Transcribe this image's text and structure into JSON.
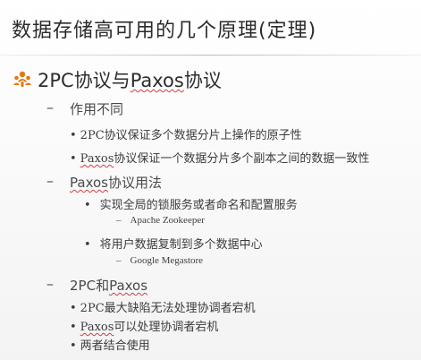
{
  "slide": {
    "title": "数据存储高可用的几个原理(定理)",
    "heading": {
      "prefix": "2PC协议与",
      "paxos": "Paxos",
      "suffix": "协议"
    },
    "sections": [
      {
        "dash": "–",
        "label": "作用不同",
        "items": [
          {
            "bullet": "•",
            "pre": "2PC协议保证多个数据分片上操作的原子性",
            "paxos": "",
            "post": ""
          },
          {
            "bullet": "•",
            "pre": "",
            "paxos": "Paxos",
            "post": "协议保证一个数据分片多个副本之间的数据一致性"
          }
        ]
      },
      {
        "dash": "–",
        "label_paxos": "Paxos",
        "label_post": "协议用法",
        "items": [
          {
            "bullet": "•",
            "text": "实现全局的锁服务或者命名和配置服务",
            "sub_dash": "–",
            "sub": "Apache Zookeeper"
          },
          {
            "bullet": "•",
            "text": "将用户数据复制到多个数据中心",
            "sub_dash": "–",
            "sub": "Google Megastore"
          }
        ]
      },
      {
        "dash": "–",
        "label_pre": "2PC和",
        "label_paxos": "Paxos",
        "items": [
          {
            "bullet": "•",
            "pre": "2PC最大缺陷无法处理协调者宕机",
            "paxos": "",
            "post": ""
          },
          {
            "bullet": "•",
            "pre": "",
            "paxos": "Paxos",
            "post": "可以处理协调者宕机"
          },
          {
            "bullet": "•",
            "pre": "两者结合使用",
            "paxos": "",
            "post": ""
          }
        ]
      }
    ]
  },
  "colors": {
    "icon_orange": "#e07a10",
    "spell_underline": "#d04040"
  },
  "icons": {
    "heading_icon": "people-group-icon"
  }
}
